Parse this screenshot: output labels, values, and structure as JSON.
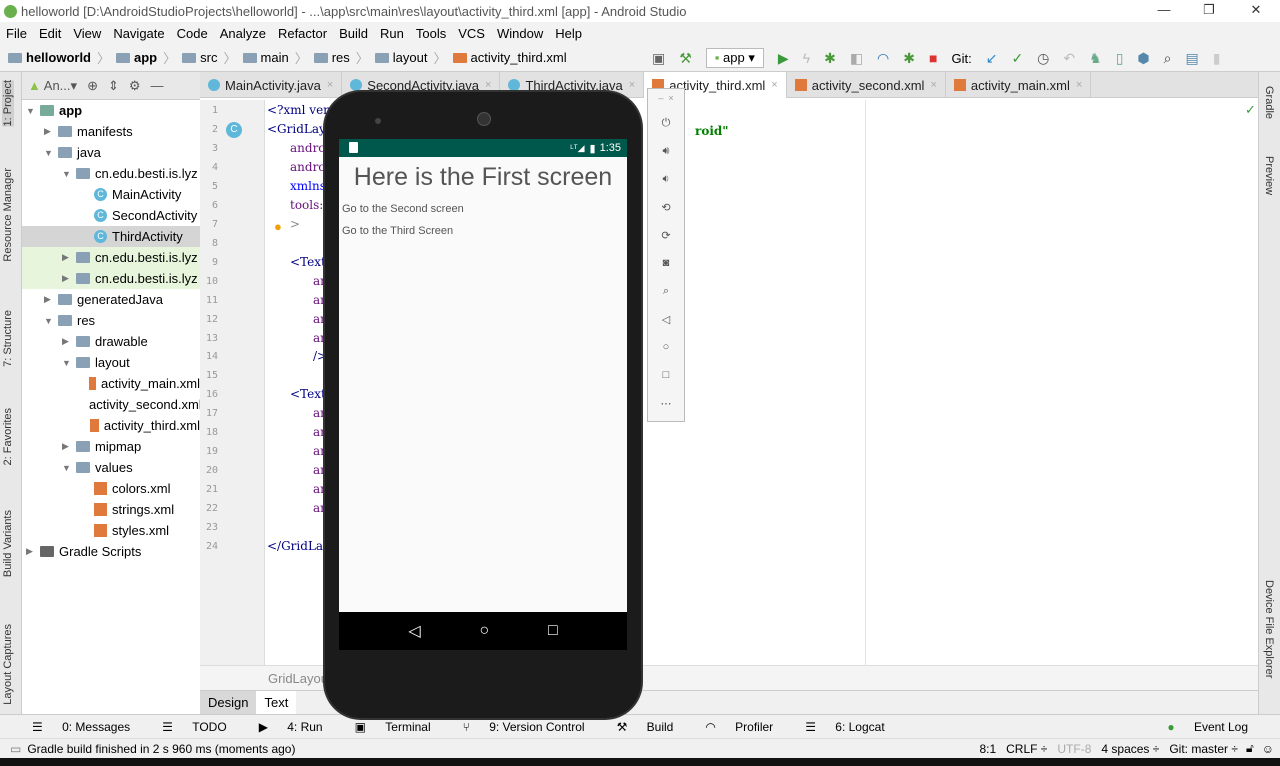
{
  "window": {
    "title": "helloworld [D:\\AndroidStudioProjects\\helloworld] - ...\\app\\src\\main\\res\\layout\\activity_third.xml [app] - Android Studio",
    "minimize": "—",
    "maximize": "❐",
    "close": "✕"
  },
  "menu": [
    "File",
    "Edit",
    "View",
    "Navigate",
    "Code",
    "Analyze",
    "Refactor",
    "Build",
    "Run",
    "Tools",
    "VCS",
    "Window",
    "Help"
  ],
  "breadcrumb": [
    "helloworld",
    "app",
    "src",
    "main",
    "res",
    "layout",
    "activity_third.xml"
  ],
  "toolbar": {
    "run_config": "app",
    "git_label": "Git:"
  },
  "left_tools": [
    "1: Project",
    "Resource Manager",
    "7: Structure",
    "2: Favorites",
    "Build Variants",
    "Layout Captures"
  ],
  "right_tools": [
    "Gradle",
    "Preview",
    "Device File Explorer"
  ],
  "project_panel": {
    "view": "An...",
    "tree": [
      {
        "label": "app",
        "depth": 0,
        "kind": "module",
        "open": true
      },
      {
        "label": "manifests",
        "depth": 1,
        "kind": "folder",
        "open": false
      },
      {
        "label": "java",
        "depth": 1,
        "kind": "folder",
        "open": true
      },
      {
        "label": "cn.edu.besti.is.lyz",
        "depth": 2,
        "kind": "folder",
        "open": true
      },
      {
        "label": "MainActivity",
        "depth": 3,
        "kind": "class"
      },
      {
        "label": "SecondActivity",
        "depth": 3,
        "kind": "class"
      },
      {
        "label": "ThirdActivity",
        "depth": 3,
        "kind": "class",
        "selected": true
      },
      {
        "label": "cn.edu.besti.is.lyz",
        "depth": 2,
        "kind": "folder",
        "open": false,
        "green": true
      },
      {
        "label": "cn.edu.besti.is.lyz",
        "depth": 2,
        "kind": "folder",
        "open": false,
        "green": true
      },
      {
        "label": "generatedJava",
        "depth": 1,
        "kind": "folder",
        "open": false
      },
      {
        "label": "res",
        "depth": 1,
        "kind": "folder",
        "open": true
      },
      {
        "label": "drawable",
        "depth": 2,
        "kind": "folder",
        "open": false
      },
      {
        "label": "layout",
        "depth": 2,
        "kind": "folder",
        "open": true
      },
      {
        "label": "activity_main.xml",
        "depth": 3,
        "kind": "xml"
      },
      {
        "label": "activity_second.xml",
        "depth": 3,
        "kind": "xml"
      },
      {
        "label": "activity_third.xml",
        "depth": 3,
        "kind": "xml"
      },
      {
        "label": "mipmap",
        "depth": 2,
        "kind": "folder",
        "open": false
      },
      {
        "label": "values",
        "depth": 2,
        "kind": "folder",
        "open": true
      },
      {
        "label": "colors.xml",
        "depth": 3,
        "kind": "xml"
      },
      {
        "label": "strings.xml",
        "depth": 3,
        "kind": "xml"
      },
      {
        "label": "styles.xml",
        "depth": 3,
        "kind": "xml"
      },
      {
        "label": "Gradle Scripts",
        "depth": 0,
        "kind": "gradle",
        "open": false
      }
    ]
  },
  "editor_tabs": [
    {
      "label": "MainActivity.java",
      "kind": "class"
    },
    {
      "label": "SecondActivity.java",
      "kind": "class"
    },
    {
      "label": "ThirdActivity.java",
      "kind": "class"
    },
    {
      "label": "activity_third.xml",
      "kind": "xml",
      "active": true
    },
    {
      "label": "activity_second.xml",
      "kind": "xml"
    },
    {
      "label": "activity_main.xml",
      "kind": "xml"
    }
  ],
  "code_lines": [
    {
      "n": "1",
      "text": "<?xml vers",
      "indent": 0,
      "color": "#000080"
    },
    {
      "n": "2",
      "text": "<GridLayou",
      "indent": 0,
      "color": "#000080"
    },
    {
      "n": "3",
      "text": "andro",
      "indent": 2,
      "color": "#660e7a"
    },
    {
      "n": "4",
      "text": "andro",
      "indent": 2,
      "color": "#660e7a"
    },
    {
      "n": "5",
      "text": "xmlns:",
      "indent": 2,
      "color": "#0000ff"
    },
    {
      "n": "6",
      "text": "tools:",
      "indent": 2,
      "color": "#660e7a"
    },
    {
      "n": "7",
      "text": ">",
      "indent": 2,
      "color": "#888"
    },
    {
      "n": "8",
      "text": "",
      "indent": 0,
      "color": "#000"
    },
    {
      "n": "9",
      "text": "<TextV",
      "indent": 2,
      "color": "#000080"
    },
    {
      "n": "10",
      "text": "an",
      "indent": 4,
      "color": "#660e7a"
    },
    {
      "n": "11",
      "text": "an",
      "indent": 4,
      "color": "#660e7a"
    },
    {
      "n": "12",
      "text": "an",
      "indent": 4,
      "color": "#660e7a"
    },
    {
      "n": "13",
      "text": "an",
      "indent": 4,
      "color": "#660e7a"
    },
    {
      "n": "14",
      "text": "/>",
      "indent": 4,
      "color": "#000080"
    },
    {
      "n": "15",
      "text": "",
      "indent": 0,
      "color": "#000"
    },
    {
      "n": "16",
      "text": "<TextV",
      "indent": 2,
      "color": "#000080"
    },
    {
      "n": "17",
      "text": "an",
      "indent": 4,
      "color": "#660e7a"
    },
    {
      "n": "18",
      "text": "an",
      "indent": 4,
      "color": "#660e7a"
    },
    {
      "n": "19",
      "text": "an",
      "indent": 4,
      "color": "#660e7a"
    },
    {
      "n": "20",
      "text": "an",
      "indent": 4,
      "color": "#660e7a"
    },
    {
      "n": "21",
      "text": "an",
      "indent": 4,
      "color": "#660e7a"
    },
    {
      "n": "22",
      "text": "an",
      "indent": 4,
      "color": "#660e7a"
    },
    {
      "n": "23",
      "text": "",
      "indent": 0,
      "color": "#000"
    },
    {
      "n": "24",
      "text": "</GridLayo",
      "indent": 0,
      "color": "#000080"
    }
  ],
  "code_fragment_right": "roid\"",
  "editor_breadcrumb": "GridLayout",
  "design_tabs": [
    "Design",
    "Text"
  ],
  "tool_windows": [
    "0: Messages",
    "TODO",
    "4: Run",
    "Terminal",
    "9: Version Control",
    "Build",
    "Profiler",
    "6: Logcat"
  ],
  "event_log": "Event Log",
  "status": {
    "message": "Gradle build finished in 2 s 960 ms (moments ago)",
    "position": "8:1",
    "line_sep": "CRLF ÷",
    "encoding": "UTF-8",
    "indent": "4 spaces ÷",
    "git": "Git: master ÷"
  },
  "emulator": {
    "time": "1:35",
    "title": "Here is the First screen",
    "link1": "Go to the Second screen",
    "link2": "Go to the Third Screen",
    "status_bar_color": "#00574b",
    "side_buttons": [
      "power",
      "volume-up",
      "volume-down",
      "rotate-left",
      "rotate-right",
      "screenshot",
      "zoom",
      "back",
      "home",
      "overview",
      "more"
    ]
  }
}
